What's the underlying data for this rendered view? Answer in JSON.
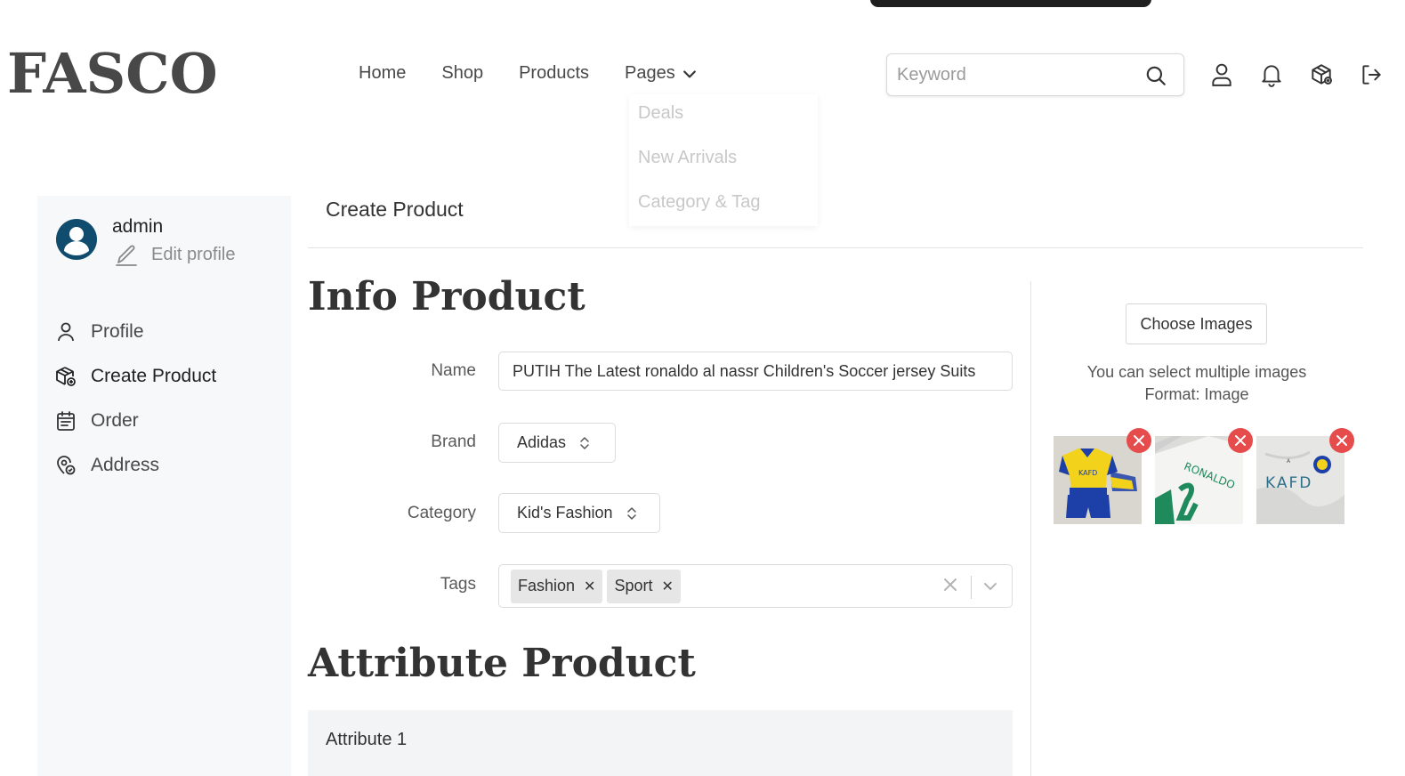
{
  "brand": {
    "logo": "FASCO"
  },
  "nav": {
    "items": [
      "Home",
      "Shop",
      "Products",
      "Pages"
    ],
    "dropdown": [
      "Deals",
      "New Arrivals",
      "Category & Tag"
    ]
  },
  "search": {
    "placeholder": "Keyword"
  },
  "header_icons": [
    "user-icon",
    "bell-icon",
    "box-icon",
    "logout-icon"
  ],
  "sidebar": {
    "username": "admin",
    "edit_profile": "Edit profile",
    "items": [
      {
        "label": "Profile",
        "icon": "user-icon"
      },
      {
        "label": "Create Product",
        "icon": "package-plus-icon"
      },
      {
        "label": "Order",
        "icon": "calendar-list-icon"
      },
      {
        "label": "Address",
        "icon": "location-icon"
      }
    ]
  },
  "main": {
    "page_title": "Create Product",
    "info_heading": "Info Product",
    "attribute_heading": "Attribute Product",
    "form": {
      "name_label": "Name",
      "name_value": "PUTIH The Latest ronaldo al nassr Children's Soccer jersey Suits",
      "brand_label": "Brand",
      "brand_value": "Adidas",
      "category_label": "Category",
      "category_value": "Kid's Fashion",
      "tags_label": "Tags",
      "tags": [
        "Fashion",
        "Sport"
      ]
    },
    "attribute_panel": {
      "title": "Attribute 1"
    }
  },
  "images": {
    "choose_label": "Choose Images",
    "note_line1": "You can select multiple images",
    "note_line2": "Format: Image",
    "thumbnails": [
      {
        "name": "yellow-blue-jersey-kit"
      },
      {
        "name": "white-ronaldo-jersey-back"
      },
      {
        "name": "white-kafd-jersey-front"
      }
    ]
  },
  "colors": {
    "text": "#484848",
    "sidebar_bg": "#f7f8f9",
    "remove_badge": "#e74c4c",
    "avatar": "#0f4c6e"
  }
}
